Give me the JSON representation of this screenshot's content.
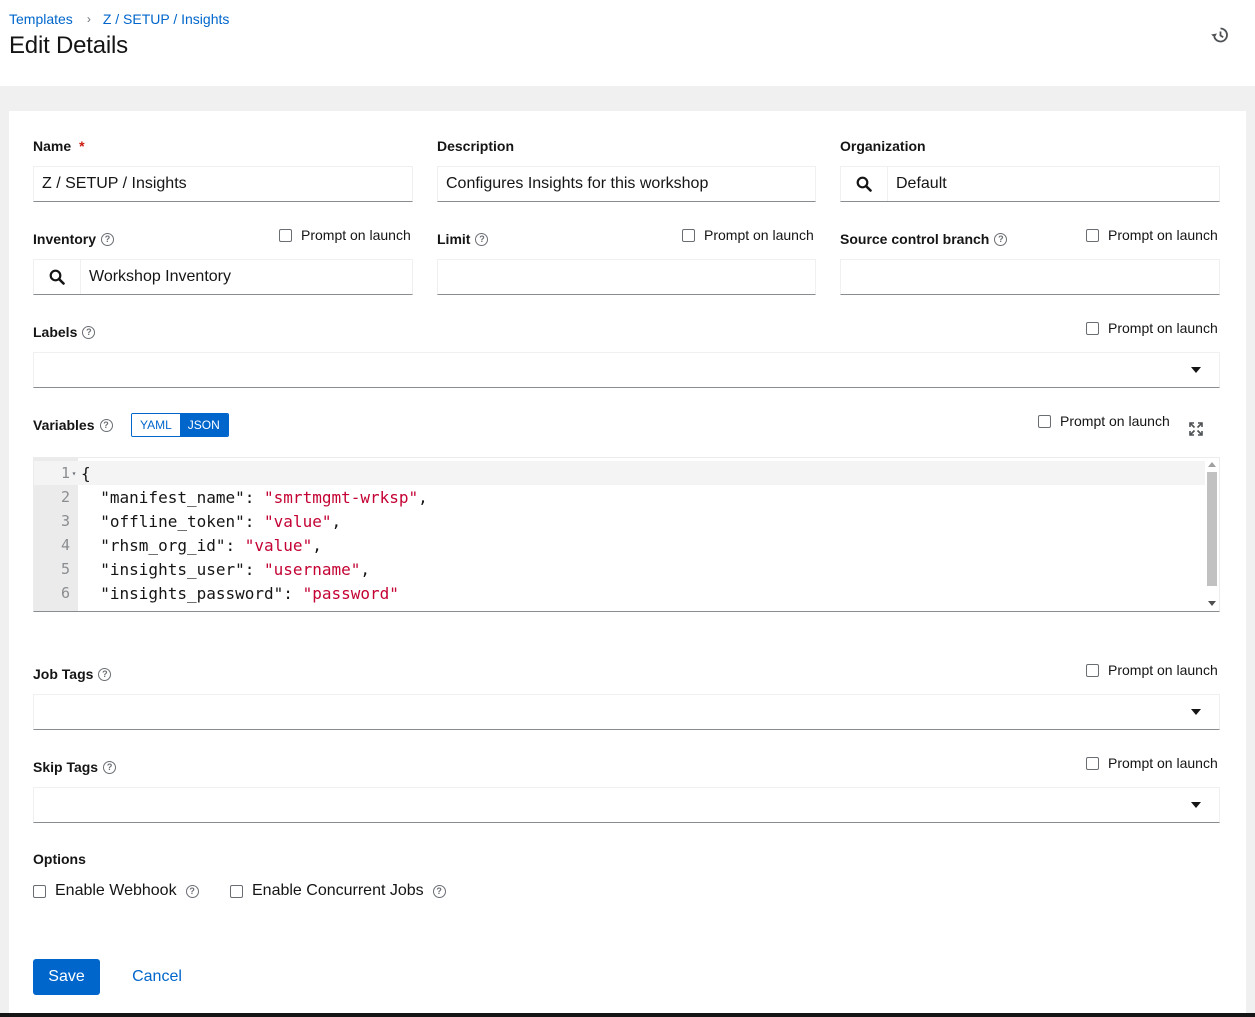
{
  "breadcrumb": {
    "items": [
      "Templates",
      "Z / SETUP / Insights"
    ],
    "separator": "›"
  },
  "page": {
    "title": "Edit Details"
  },
  "form": {
    "name": {
      "label": "Name",
      "required_mark": "*",
      "value": "Z / SETUP / Insights"
    },
    "description": {
      "label": "Description",
      "value": "Configures Insights for this workshop"
    },
    "organization": {
      "label": "Organization",
      "value": "Default"
    },
    "inventory": {
      "label": "Inventory",
      "value": "Workshop Inventory",
      "prompt": "Prompt on launch"
    },
    "limit": {
      "label": "Limit",
      "value": "",
      "prompt": "Prompt on launch"
    },
    "scm_branch": {
      "label": "Source control branch",
      "value": "",
      "prompt": "Prompt on launch"
    },
    "labels": {
      "label": "Labels",
      "prompt": "Prompt on launch"
    },
    "variables": {
      "label": "Variables",
      "mode_yaml": "YAML",
      "mode_json": "JSON",
      "active_mode": "JSON",
      "prompt": "Prompt on launch",
      "lines": [
        {
          "n": "1",
          "text": "{"
        },
        {
          "n": "2",
          "key": "  \"manifest_name\": ",
          "val": "\"smrtmgmt-wrksp\"",
          "tail": ","
        },
        {
          "n": "3",
          "key": "  \"offline_token\": ",
          "val": "\"value\"",
          "tail": ","
        },
        {
          "n": "4",
          "key": "  \"rhsm_org_id\": ",
          "val": "\"value\"",
          "tail": ","
        },
        {
          "n": "5",
          "key": "  \"insights_user\": ",
          "val": "\"username\"",
          "tail": ","
        },
        {
          "n": "6",
          "key": "  \"insights_password\": ",
          "val": "\"password\"",
          "tail": ""
        }
      ]
    },
    "job_tags": {
      "label": "Job Tags",
      "prompt": "Prompt on launch"
    },
    "skip_tags": {
      "label": "Skip Tags",
      "prompt": "Prompt on launch"
    },
    "options": {
      "label": "Options",
      "enable_webhook": "Enable Webhook",
      "enable_concurrent": "Enable Concurrent Jobs"
    }
  },
  "actions": {
    "save": "Save",
    "cancel": "Cancel"
  },
  "colors": {
    "primary": "#0066cc",
    "required": "#c9190b",
    "string": "#c40233"
  },
  "icons": [
    "history-icon",
    "search-icon",
    "help-icon",
    "caret-down-icon",
    "expand-icon"
  ]
}
